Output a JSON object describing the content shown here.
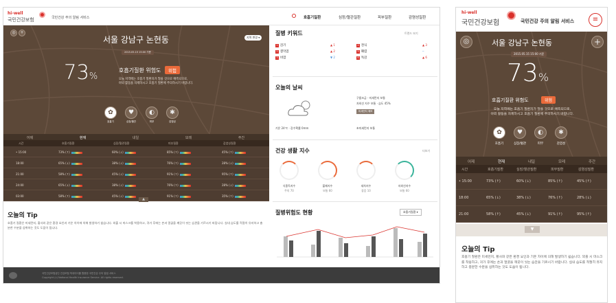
{
  "brand": {
    "tag": "hi-well",
    "name": "국민건강보험",
    "service": "국민건강 주의 알림 서비스"
  },
  "nav": [
    "호흡기질환",
    "심장/혈관질환",
    "피부질환",
    "감염성질환"
  ],
  "hero": {
    "location": "서울 강남구 논현동",
    "date": "2015.05.15 15:00 기준",
    "percent": "73",
    "percent_sign": "%",
    "label": "호흡기질환 위험도",
    "level": "위험",
    "description_line1": "오늘 지역에는 호흡기 질환자가 많을 것으로 예측되므로,",
    "description_line2": "야외 활동을 자제하시고 호흡기 질환에 주의하시기 바랍니다.",
    "change_button": "지역 변경 ▾",
    "icons": [
      {
        "icon": "lungs-icon",
        "label": "호흡기"
      },
      {
        "icon": "heart-icon",
        "label": "심장/혈관"
      },
      {
        "icon": "skin-icon",
        "label": "피부"
      },
      {
        "icon": "virus-icon",
        "label": "감염성"
      }
    ]
  },
  "tabs": [
    "어제",
    "현재",
    "내일",
    "모레",
    "주간"
  ],
  "table": {
    "headers": [
      "시간",
      "호흡기질환",
      "심장/혈관질환",
      "피부질환",
      "감염성질환"
    ],
    "rows": [
      [
        "• 15:00",
        "73% (↑)",
        "60% (↓)",
        "85% (↑)",
        "45% (↑)"
      ],
      [
        "18:00",
        "65% (↓)",
        "38% (↓)",
        "76% (↑)",
        "28% (↓)"
      ],
      [
        "21:00",
        "58% (↑)",
        "45% (↓)",
        "91% (↑)",
        "95% (↑)"
      ],
      [
        "24:00",
        "65% (↓)",
        "38% (↓)",
        "76% (↑)",
        "28% (↓)"
      ],
      [
        "03:00",
        "58% (↑)",
        "45% (↓)",
        "91% (↑)",
        "35% (↑)"
      ]
    ]
  },
  "tip": {
    "title": "오늘의 Tip",
    "text": "호흡기 질환은 미세먼지, 황사와 같은 환경 요인과 기온 차이에 의해 발생하기 쉽습니다. 외출 시 마스크를 착용하고, 귀가 후에는 손과 얼굴을 깨끗이 씻는 습관을 기르시기 바랍니다. 실내 습도를 적절히 유지하고 충분한 수분을 섭취하는 것도 도움이 됩니다."
  },
  "keywords": {
    "title": "질병 키워드",
    "more": "트렌드 보기",
    "items": [
      {
        "rank": "1",
        "text": "감기",
        "change": "▲ 1"
      },
      {
        "rank": "2",
        "text": "결막염",
        "change": "▲ 2"
      },
      {
        "rank": "3",
        "text": "비염",
        "change": "▼ 2"
      },
      {
        "rank": "4",
        "text": "천식",
        "change": "▲ 3"
      },
      {
        "rank": "5",
        "text": "폐렴",
        "change": "─"
      },
      {
        "rank": "6",
        "text": "독감",
        "change": "▲ 6"
      }
    ]
  },
  "weather": {
    "title": "오늘의 날씨",
    "line1": "구름조금 · 미세먼지 보통",
    "line2": "자외선 지수 보통 · 습도 45%",
    "temp": "기온 24℃ · 강수확률 0mm",
    "badge": "미세먼지 예보",
    "sub": "초미세먼지 보통"
  },
  "life": {
    "title": "건강 생활 지수",
    "more": "더보기",
    "items": [
      {
        "name": "식중독지수",
        "value": "주의 70"
      },
      {
        "name": "불쾌지수",
        "value": "보통 60"
      },
      {
        "name": "세차지수",
        "value": "좋음 10"
      },
      {
        "name": "자외선지수",
        "value": "보통 60"
      }
    ]
  },
  "risk": {
    "title": "질병위험도 현황",
    "select": "호흡기질환 ▾"
  },
  "footer": {
    "line1": "국민건강보험공단 건강보험 빅데이터를 활용한 국민건강 주의 알림 서비스",
    "line2": "Copyright (c) National Health Insurance Service. All rights reserved."
  }
}
